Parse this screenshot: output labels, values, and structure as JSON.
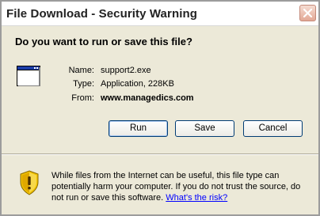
{
  "window": {
    "title": "File Download - Security Warning"
  },
  "question": "Do you want to run or save this file?",
  "file": {
    "icon": "application-window-icon",
    "name_label": "Name:",
    "name_value": "support2.exe",
    "type_label": "Type:",
    "type_value": "Application, 228KB",
    "from_label": "From:",
    "from_value": "www.managedics.com"
  },
  "buttons": {
    "run": "Run",
    "save": "Save",
    "cancel": "Cancel"
  },
  "warning": {
    "icon": "shield-warning-icon",
    "text": "While files from the Internet can be useful, this file type can potentially harm your computer. If you do not trust the source, do not run or save this software.",
    "link_text": "What's the risk?"
  },
  "colors": {
    "dialog_bg": "#ece9d8",
    "titlebar_bg": "#ffffff",
    "close_button": "#e3a895",
    "link": "#0000ff",
    "shield_yellow": "#f2c200"
  }
}
